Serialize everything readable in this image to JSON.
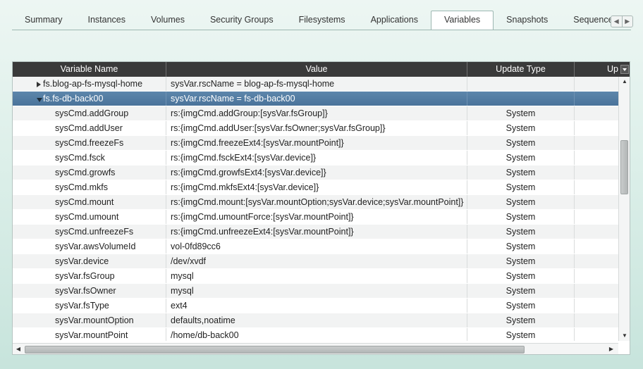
{
  "tabs": [
    {
      "label": "Summary",
      "active": false
    },
    {
      "label": "Instances",
      "active": false
    },
    {
      "label": "Volumes",
      "active": false
    },
    {
      "label": "Security Groups",
      "active": false
    },
    {
      "label": "Filesystems",
      "active": false
    },
    {
      "label": "Applications",
      "active": false
    },
    {
      "label": "Variables",
      "active": true
    },
    {
      "label": "Snapshots",
      "active": false
    },
    {
      "label": "Sequence",
      "active": false
    }
  ],
  "grid": {
    "columns": [
      "Variable Name",
      "Value",
      "Update Type",
      "Up"
    ],
    "group_rows": [
      {
        "name": "fs.blog-ap-fs-mysql-home",
        "value": "sysVar.rscName = blog-ap-fs-mysql-home",
        "expanded": false
      },
      {
        "name": "fs.fs-db-back00",
        "value": "sysVar.rscName = fs-db-back00",
        "expanded": true
      }
    ],
    "rows": [
      {
        "name": "sysCmd.addGroup",
        "value": "rs:{imgCmd.addGroup:[sysVar.fsGroup]}",
        "type": "System"
      },
      {
        "name": "sysCmd.addUser",
        "value": "rs:{imgCmd.addUser:[sysVar.fsOwner;sysVar.fsGroup]}",
        "type": "System"
      },
      {
        "name": "sysCmd.freezeFs",
        "value": "rs:{imgCmd.freezeExt4:[sysVar.mountPoint]}",
        "type": "System"
      },
      {
        "name": "sysCmd.fsck",
        "value": "rs:{imgCmd.fsckExt4:[sysVar.device]}",
        "type": "System"
      },
      {
        "name": "sysCmd.growfs",
        "value": "rs:{imgCmd.growfsExt4:[sysVar.device]}",
        "type": "System"
      },
      {
        "name": "sysCmd.mkfs",
        "value": "rs:{imgCmd.mkfsExt4:[sysVar.device]}",
        "type": "System"
      },
      {
        "name": "sysCmd.mount",
        "value": "rs:{imgCmd.mount:[sysVar.mountOption;sysVar.device;sysVar.mountPoint]}",
        "type": "System"
      },
      {
        "name": "sysCmd.umount",
        "value": "rs:{imgCmd.umountForce:[sysVar.mountPoint]}",
        "type": "System"
      },
      {
        "name": "sysCmd.unfreezeFs",
        "value": "rs:{imgCmd.unfreezeExt4:[sysVar.mountPoint]}",
        "type": "System"
      },
      {
        "name": "sysVar.awsVolumeId",
        "value": "vol-0fd89cc6",
        "type": "System"
      },
      {
        "name": "sysVar.device",
        "value": "/dev/xvdf",
        "type": "System"
      },
      {
        "name": "sysVar.fsGroup",
        "value": "mysql",
        "type": "System"
      },
      {
        "name": "sysVar.fsOwner",
        "value": "mysql",
        "type": "System"
      },
      {
        "name": "sysVar.fsType",
        "value": "ext4",
        "type": "System"
      },
      {
        "name": "sysVar.mountOption",
        "value": "defaults,noatime",
        "type": "System"
      },
      {
        "name": "sysVar.mountPoint",
        "value": "/home/db-back00",
        "type": "System"
      }
    ]
  },
  "colors": {
    "header_bg": "#3a3a3a",
    "selected_row": "#4f789e",
    "accent_border": "#9db7b2"
  }
}
